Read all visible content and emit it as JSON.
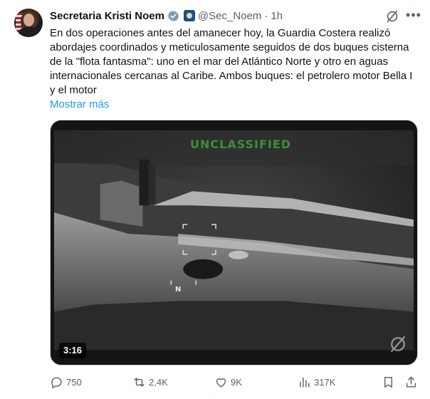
{
  "author": {
    "name": "Secretaria Kristi Noem",
    "handle": "@Sec_Noem",
    "separator": "·",
    "time": "1h"
  },
  "post": {
    "text": "En dos operaciones antes del amanecer hoy, la Guardia Costera realizó abordajes coordinados y meticulosamente seguidos de dos buques cisterna de la \"flota fantasma\": uno en el mar del Atlántico Norte y otro en aguas internacionales cercanas al Caribe. Ambos buques: el petrolero motor Bella I y el motor",
    "show_more": "Mostrar más"
  },
  "media": {
    "overlay_text": "UNCLASSIFIED",
    "compass_label": "N",
    "duration": "3:16"
  },
  "actions": {
    "replies": "750",
    "reposts": "2,4K",
    "likes": "9K",
    "views": "317K"
  },
  "colors": {
    "text_primary": "#0f1419",
    "text_secondary": "#536471",
    "link": "#1d9bf0",
    "verified": "#829aab",
    "overlay_green": "#3a8f3a"
  },
  "icons": [
    "verified-badge-icon",
    "government-badge-icon",
    "grok-icon",
    "more-icon",
    "reply-icon",
    "repost-icon",
    "like-icon",
    "views-icon",
    "bookmark-icon",
    "share-icon"
  ]
}
